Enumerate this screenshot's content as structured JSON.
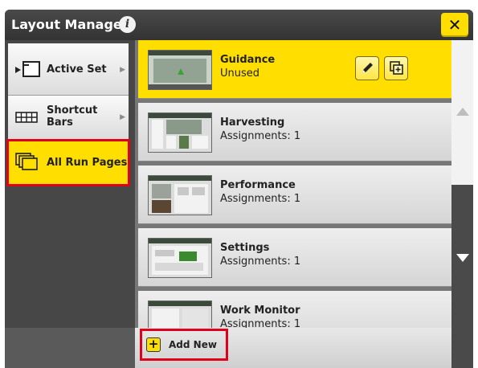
{
  "window": {
    "title": "Layout Manager",
    "info_icon": "info-icon",
    "close_label": "✕"
  },
  "sidebar": {
    "items": [
      {
        "label": "Active Set",
        "icon": "active-set-icon",
        "active": false
      },
      {
        "label": "Shortcut Bars",
        "icon": "shortcut-bars-icon",
        "active": false
      },
      {
        "label": "All Run Pages",
        "icon": "run-pages-icon",
        "active": true
      }
    ]
  },
  "run_pages": [
    {
      "name": "Guidance",
      "status": "Unused",
      "selected": true
    },
    {
      "name": "Harvesting",
      "status": "Assignments: 1",
      "selected": false
    },
    {
      "name": "Performance",
      "status": "Assignments: 1",
      "selected": false
    },
    {
      "name": "Settings",
      "status": "Assignments: 1",
      "selected": false
    },
    {
      "name": "Work Monitor",
      "status": "Assignments: 1",
      "selected": false
    }
  ],
  "actions": {
    "edit_icon": "pencil-icon",
    "copy_icon": "copy-plus-icon"
  },
  "footer": {
    "add_new_label": "Add New",
    "add_icon_glyph": "+"
  },
  "colors": {
    "accent": "#ffde00",
    "highlight": "#e0001a",
    "chrome": "#3d3d3d"
  }
}
